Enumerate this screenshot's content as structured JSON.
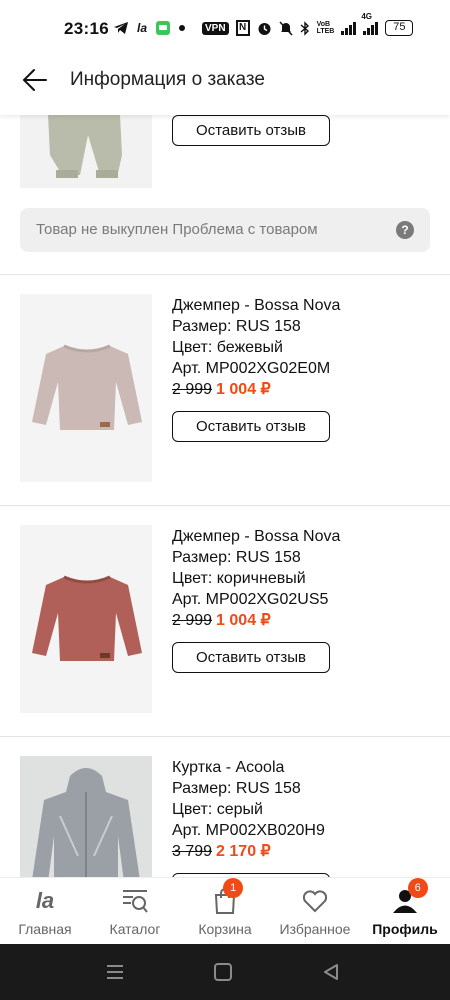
{
  "status_bar": {
    "time": "23:16",
    "vpn": "VPN",
    "nfc": "N",
    "lte_top": "VoB",
    "lte_bottom": "LTEB",
    "network": "4G",
    "battery": "75"
  },
  "header": {
    "title": "Информация о заказе"
  },
  "first_item": {
    "review_label": "Оставить отзыв",
    "problem_text": "Товар не выкуплен Проблема с товаром",
    "help_glyph": "?"
  },
  "items": [
    {
      "name": "Джемпер - Bossa Nova",
      "size": "Размер: RUS 158",
      "color": "Цвет: бежевый",
      "sku": "Арт. MP002XG02E0M",
      "old_price": "2 999",
      "new_price": "1 004 ₽",
      "review_label": "Оставить отзыв",
      "image_color": "#cbb9b6"
    },
    {
      "name": "Джемпер - Bossa Nova",
      "size": "Размер: RUS 158",
      "color": "Цвет: коричневый",
      "sku": "Арт. MP002XG02US5",
      "old_price": "2 999",
      "new_price": "1 004 ₽",
      "review_label": "Оставить отзыв",
      "image_color": "#b06058"
    },
    {
      "name": "Куртка - Acoola",
      "size": "Размер: RUS 158",
      "color": "Цвет: серый",
      "sku": "Арт. MP002XB020H9",
      "old_price": "3 799",
      "new_price": "2 170 ₽",
      "image_color": "#9aa0a6"
    }
  ],
  "bottom_nav": {
    "home": "Главная",
    "home_logo": "la",
    "catalog": "Каталог",
    "cart": "Корзина",
    "cart_badge": "1",
    "favorites": "Избранное",
    "profile": "Профиль",
    "profile_badge": "6"
  },
  "colors": {
    "accent": "#f04b16",
    "text": "#111111",
    "muted": "#7a7a7a"
  }
}
